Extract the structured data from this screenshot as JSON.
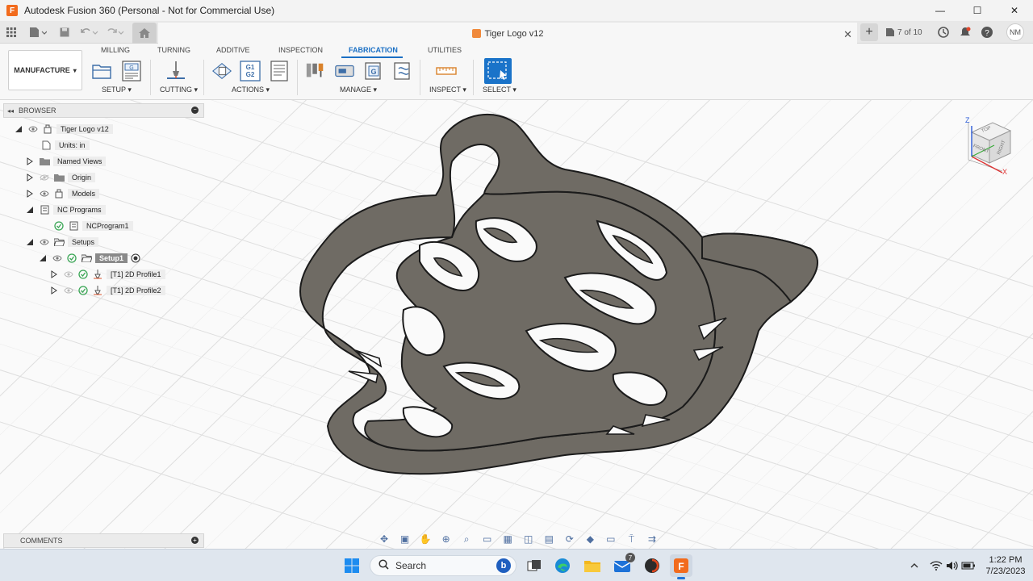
{
  "window": {
    "title": "Autodesk Fusion 360 (Personal - Not for Commercial Use)",
    "app_icon": "F"
  },
  "document": {
    "tab_title": "Tiger Logo v12",
    "version_count": "7 of 10",
    "user_initials": "NM"
  },
  "ribbon": {
    "workspace": "MANUFACTURE",
    "tabs": [
      "MILLING",
      "TURNING",
      "ADDITIVE",
      "INSPECTION",
      "FABRICATION",
      "UTILITIES"
    ],
    "active_tab": "FABRICATION",
    "groups": [
      "SETUP ▾",
      "CUTTING ▾",
      "ACTIONS ▾",
      "MANAGE ▾",
      "INSPECT ▾",
      "SELECT ▾"
    ],
    "g1g2": "G1\nG2"
  },
  "browser": {
    "title": "BROWSER",
    "items": [
      {
        "label": "Tiger Logo v12"
      },
      {
        "label": "Units: in"
      },
      {
        "label": "Named Views"
      },
      {
        "label": "Origin"
      },
      {
        "label": "Models"
      },
      {
        "label": "NC Programs"
      },
      {
        "label": "NCProgram1"
      },
      {
        "label": "Setups"
      },
      {
        "label": "Setup1"
      },
      {
        "label": "[T1] 2D Profile1"
      },
      {
        "label": "[T1] 2D Profile2"
      }
    ]
  },
  "comments": {
    "title": "COMMENTS"
  },
  "viewcube": {
    "faces": [
      "TOP",
      "FRONT",
      "RIGHT"
    ],
    "axes": [
      "Z",
      "X"
    ]
  },
  "taskbar": {
    "search_placeholder": "Search",
    "time": "1:22 PM",
    "date": "7/23/2023",
    "mail_badge": "7"
  },
  "colors": {
    "accent": "#1a6fc4",
    "part": "#6f6b64",
    "fusion_orange": "#f26b1d"
  }
}
